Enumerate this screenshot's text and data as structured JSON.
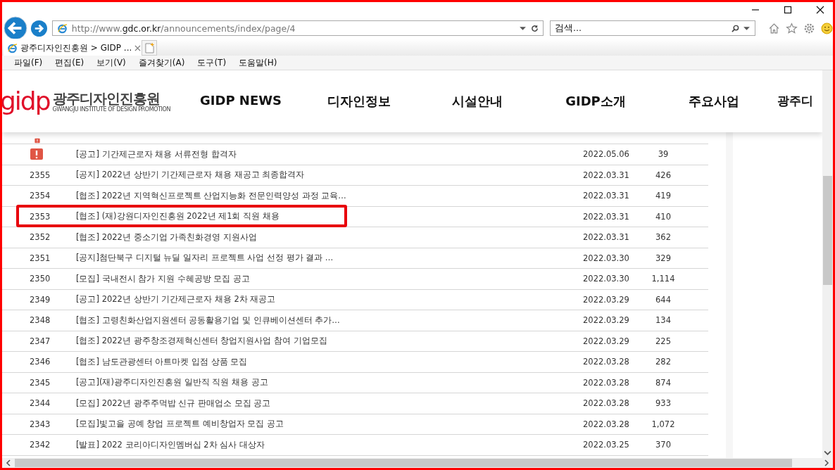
{
  "address_bar": {
    "url_prefix": "http://www.",
    "url_domain": "gdc.or.kr",
    "url_path": "/announcements/index/page/4"
  },
  "search": {
    "placeholder": "검색..."
  },
  "tabs": [
    {
      "label": "광주디자인진흥원 > GIDP ...",
      "selected": true
    }
  ],
  "menu": [
    "파일(F)",
    "편집(E)",
    "보기(V)",
    "즐겨찾기(A)",
    "도구(T)",
    "도움말(H)"
  ],
  "site": {
    "logo_mark": "gidp",
    "logo_name": "광주디자인진흥원",
    "logo_sub": "GWANGJU INSTITUTE OF DESIGN PROMOTION",
    "nav": [
      "GIDP NEWS",
      "디자인정보",
      "시설안내",
      "GIDP소개",
      "주요사업",
      "광주디"
    ]
  },
  "rows": [
    {
      "kind": "notice",
      "title": "[공고] 기간제근로자 채용 서류전형 합격자",
      "date": "2022.05.06",
      "views": "39",
      "highlighted": false
    },
    {
      "kind": "post",
      "number": "2355",
      "title": "[공지] 2022년 상반기 기간제근로자 채용 재공고 최종합격자",
      "date": "2022.03.31",
      "views": "426",
      "highlighted": false
    },
    {
      "kind": "post",
      "number": "2354",
      "title": "[협조] 2022년 지역혁신프로젝트 산업지능화 전문인력양성 과정 교육…",
      "date": "2022.03.31",
      "views": "419",
      "highlighted": false
    },
    {
      "kind": "post",
      "number": "2353",
      "title": "[협조] (재)강원디자인진흥원 2022년 제1회 직원 채용",
      "date": "2022.03.31",
      "views": "410",
      "highlighted": true
    },
    {
      "kind": "post",
      "number": "2352",
      "title": "[협조] 2022년 중소기업 가족친화경영 지원사업",
      "date": "2022.03.31",
      "views": "362",
      "highlighted": false
    },
    {
      "kind": "post",
      "number": "2351",
      "title": "[공지]첨단북구 디지털 뉴딜 일자리 프로젝트 사업 선정 평가 결과 …",
      "date": "2022.03.30",
      "views": "329",
      "highlighted": false
    },
    {
      "kind": "post",
      "number": "2350",
      "title": "[모집] 국내전시 참가 지원 수혜공방 모집 공고",
      "date": "2022.03.30",
      "views": "1,114",
      "highlighted": false
    },
    {
      "kind": "post",
      "number": "2349",
      "title": "[공고] 2022년 상반기 기간제근로자 채용 2차 재공고",
      "date": "2022.03.29",
      "views": "644",
      "highlighted": false
    },
    {
      "kind": "post",
      "number": "2348",
      "title": "[협조] 고령친화산업지원센터 공동활용기업 및 인큐베이션센터 추가…",
      "date": "2022.03.29",
      "views": "134",
      "highlighted": false
    },
    {
      "kind": "post",
      "number": "2347",
      "title": "[협조] 2022년 광주창조경제혁신센터 창업지원사업 참여 기업모집",
      "date": "2022.03.29",
      "views": "225",
      "highlighted": false
    },
    {
      "kind": "post",
      "number": "2346",
      "title": "[협조] 남도관광센터 아트마켓 입점 상품 모집",
      "date": "2022.03.28",
      "views": "282",
      "highlighted": false
    },
    {
      "kind": "post",
      "number": "2345",
      "title": "[공고](재)광주디자인진흥원 일반직 직원 채용 공고",
      "date": "2022.03.28",
      "views": "874",
      "highlighted": false
    },
    {
      "kind": "post",
      "number": "2344",
      "title": "[모집] 2022년 광주주먹밥 신규 판매업소 모집 공고",
      "date": "2022.03.28",
      "views": "933",
      "highlighted": false
    },
    {
      "kind": "post",
      "number": "2343",
      "title": "[모집]빛고을 공예 창업 프로젝트 예비창업자 모집 공고",
      "date": "2022.03.28",
      "views": "1,072",
      "highlighted": false
    },
    {
      "kind": "post",
      "number": "2342",
      "title": "[발표] 2022 코리아디자인멤버십 2차 심사 대상자",
      "date": "2022.03.25",
      "views": "370",
      "highlighted": false
    }
  ]
}
